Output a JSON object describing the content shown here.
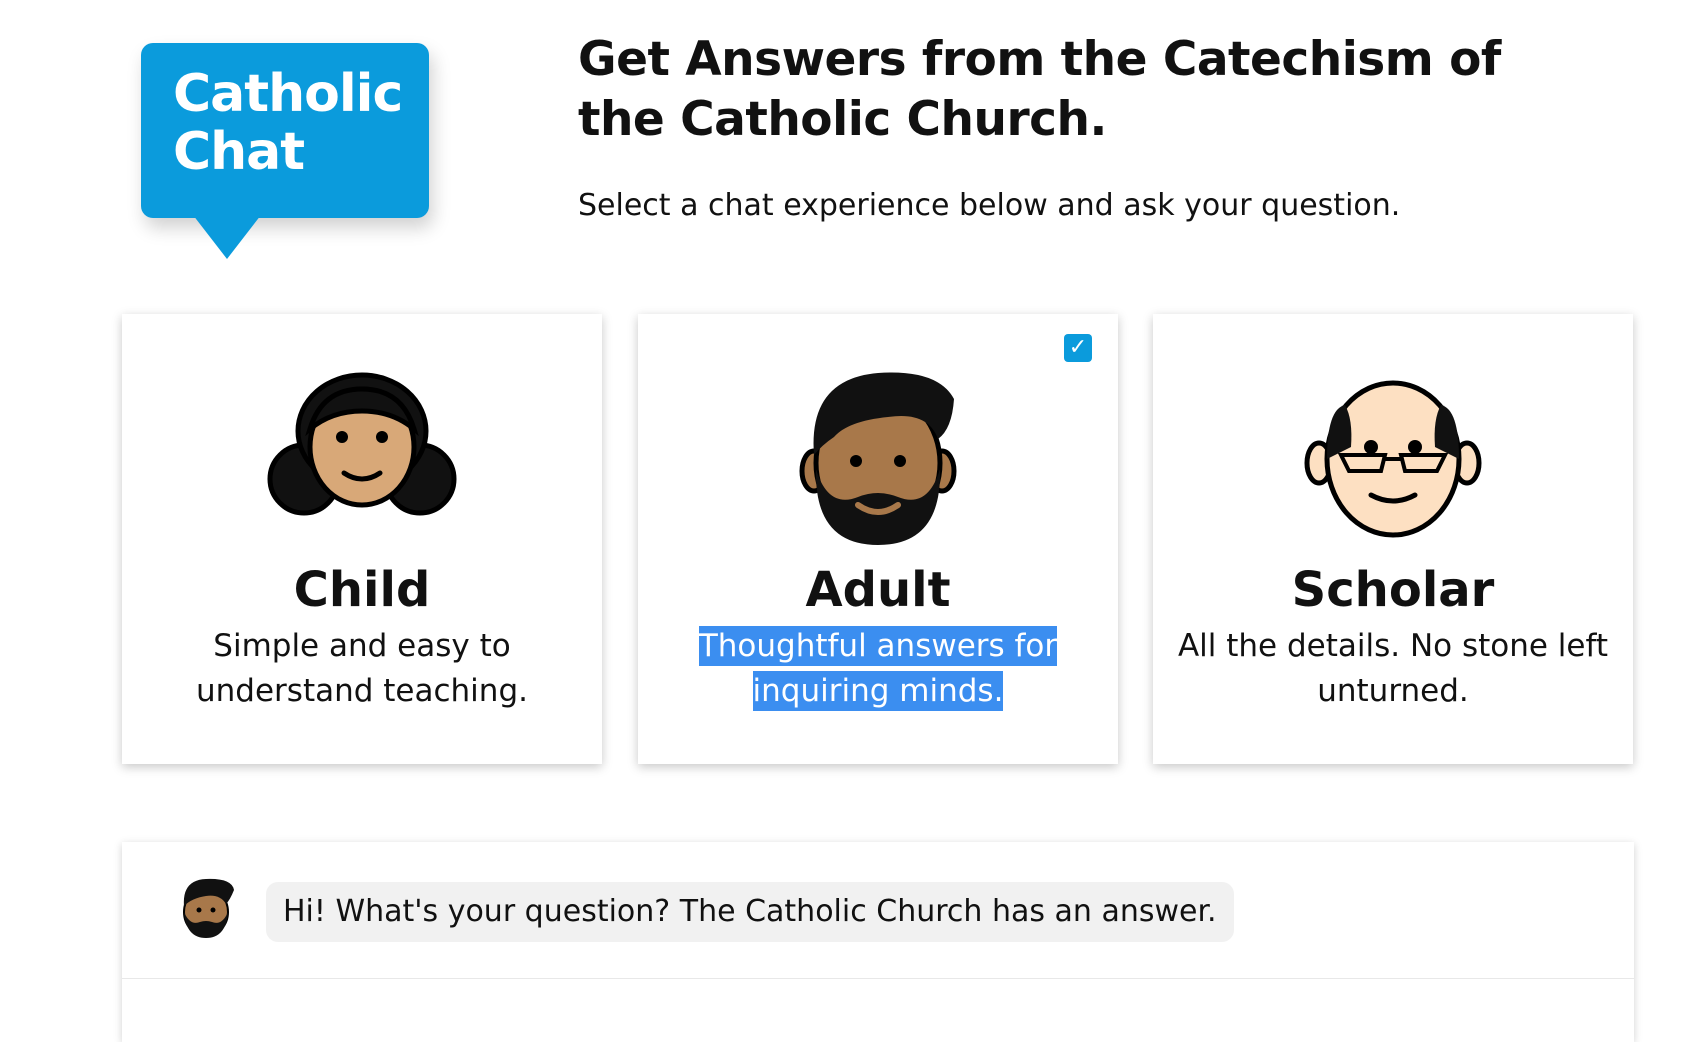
{
  "logo": {
    "line1": "Catholic",
    "line2": "Chat"
  },
  "header": {
    "title": "Get Answers from the Catechism of the Catholic Church.",
    "subtitle": "Select a chat experience below and ask your question."
  },
  "cards": [
    {
      "id": "child",
      "title": "Child",
      "desc": "Simple and easy to understand teaching.",
      "selected": false,
      "avatar": "girl-face-icon"
    },
    {
      "id": "adult",
      "title": "Adult",
      "desc": "Thoughtful answers for inquiring minds.",
      "selected": true,
      "avatar": "bearded-man-face-icon"
    },
    {
      "id": "scholar",
      "title": "Scholar",
      "desc": "All the details. No stone left unturned.",
      "selected": false,
      "avatar": "bald-man-glasses-face-icon"
    }
  ],
  "selected_checkbox": "✓",
  "chat": {
    "greeting": "Hi! What's your question? The Catholic Church has an answer."
  },
  "colors": {
    "brand": "#0b9bdc",
    "selection_highlight": "#3b8ef0"
  }
}
